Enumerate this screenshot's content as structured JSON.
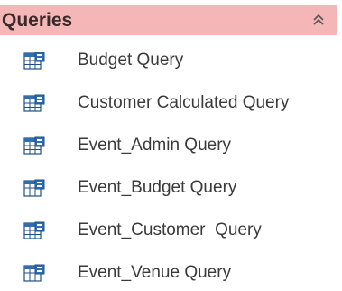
{
  "group": {
    "title": "Queries",
    "collapse_icon": "double-chevron-up-icon"
  },
  "items": [
    {
      "label": "Budget Query",
      "icon": "query-icon"
    },
    {
      "label": "Customer Calculated Query",
      "icon": "query-icon"
    },
    {
      "label": "Event_Admin Query",
      "icon": "query-icon"
    },
    {
      "label": "Event_Budget Query",
      "icon": "query-icon"
    },
    {
      "label": "Event_Customer  Query",
      "icon": "query-icon"
    },
    {
      "label": "Event_Venue Query",
      "icon": "query-icon"
    }
  ],
  "colors": {
    "header_bg": "#f4b6b6",
    "icon_blue": "#2f6fb0",
    "icon_dark": "#1f4f86",
    "text": "#3a3a3a"
  }
}
